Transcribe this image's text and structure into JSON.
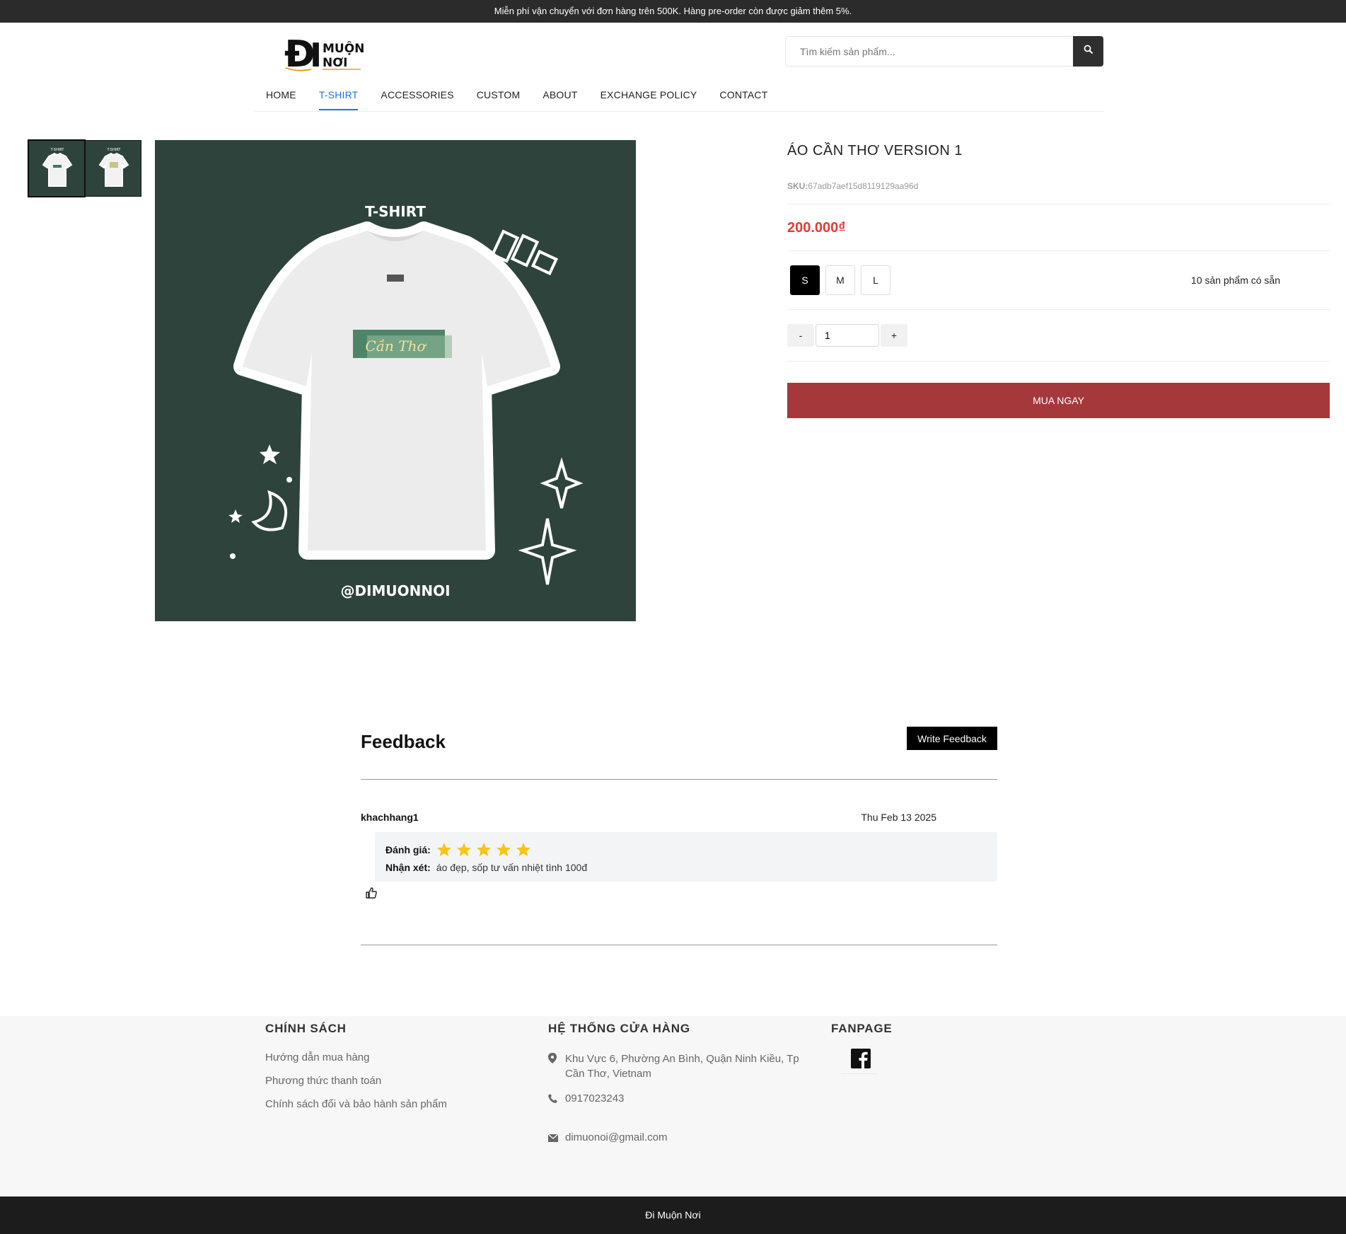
{
  "announcement": "Miễn phí vận chuyển với đơn hàng trên 500K. Hàng pre-order còn được giảm thêm 5%.",
  "header": {
    "logo": "ĐI MUỘN NƠI",
    "search_placeholder": "Tìm kiếm sản phẩm..."
  },
  "nav": [
    {
      "label": "HOME"
    },
    {
      "label": "T-SHIRT",
      "active": true
    },
    {
      "label": "ACCESSORIES"
    },
    {
      "label": "CUSTOM"
    },
    {
      "label": "ABOUT"
    },
    {
      "label": "EXCHANGE POLICY"
    },
    {
      "label": "CONTACT"
    }
  ],
  "product": {
    "image_heading": "T-SHIRT",
    "image_handle": "@DIMUONNOI",
    "image_script": "Cần Thơ",
    "title": "ÁO CẦN THƠ VERSION 1",
    "sku_label": "SKU:",
    "sku_value": "67adb7aef15d8119129aa96d",
    "price": "200.000₫",
    "sizes": [
      "S",
      "M",
      "L"
    ],
    "selected_size": "S",
    "stock": "10 sản phẩm có sẵn",
    "qty_minus": "-",
    "qty_value": "1",
    "qty_plus": "+",
    "buy_label": "MUA NGAY"
  },
  "feedback": {
    "title": "Feedback",
    "write_label": "Write Feedback",
    "items": [
      {
        "user": "khachhang1",
        "date": "Thu Feb 13 2025",
        "rating_label": "Đánh giá:",
        "rating": 5,
        "comment_label": "Nhận xét:",
        "comment": "áo đẹp, sốp tư vấn nhiệt tình 100đ"
      }
    ]
  },
  "footer": {
    "policy_title": "CHÍNH SÁCH",
    "policy_links": [
      "Hướng dẫn mua hàng",
      "Phương thức thanh toán",
      "Chính sách đổi và bảo hành sản phẩm"
    ],
    "stores_title": "HỆ THỐNG CỬA HÀNG",
    "address": "Khu Vực 6, Phường An Bình, Quận Ninh Kiều, Tp Cần Thơ, Vietnam",
    "phone": "0917023243",
    "email": "dimuonoi@gmail.com",
    "fanpage_title": "FANPAGE",
    "copyright": "Đi Muộn Nơi"
  },
  "colors": {
    "topbar": "#2b2b2b",
    "accent_nav": "#1a73e8",
    "price": "#e53935",
    "buy_button": "#a5383b",
    "product_bg": "#2e433c",
    "star": "#f5c518"
  },
  "icons": {
    "search": "search-icon",
    "like": "thumbs-up-icon",
    "location": "location-pin-icon",
    "phone": "phone-icon",
    "email": "mail-icon",
    "facebook": "facebook-icon"
  }
}
